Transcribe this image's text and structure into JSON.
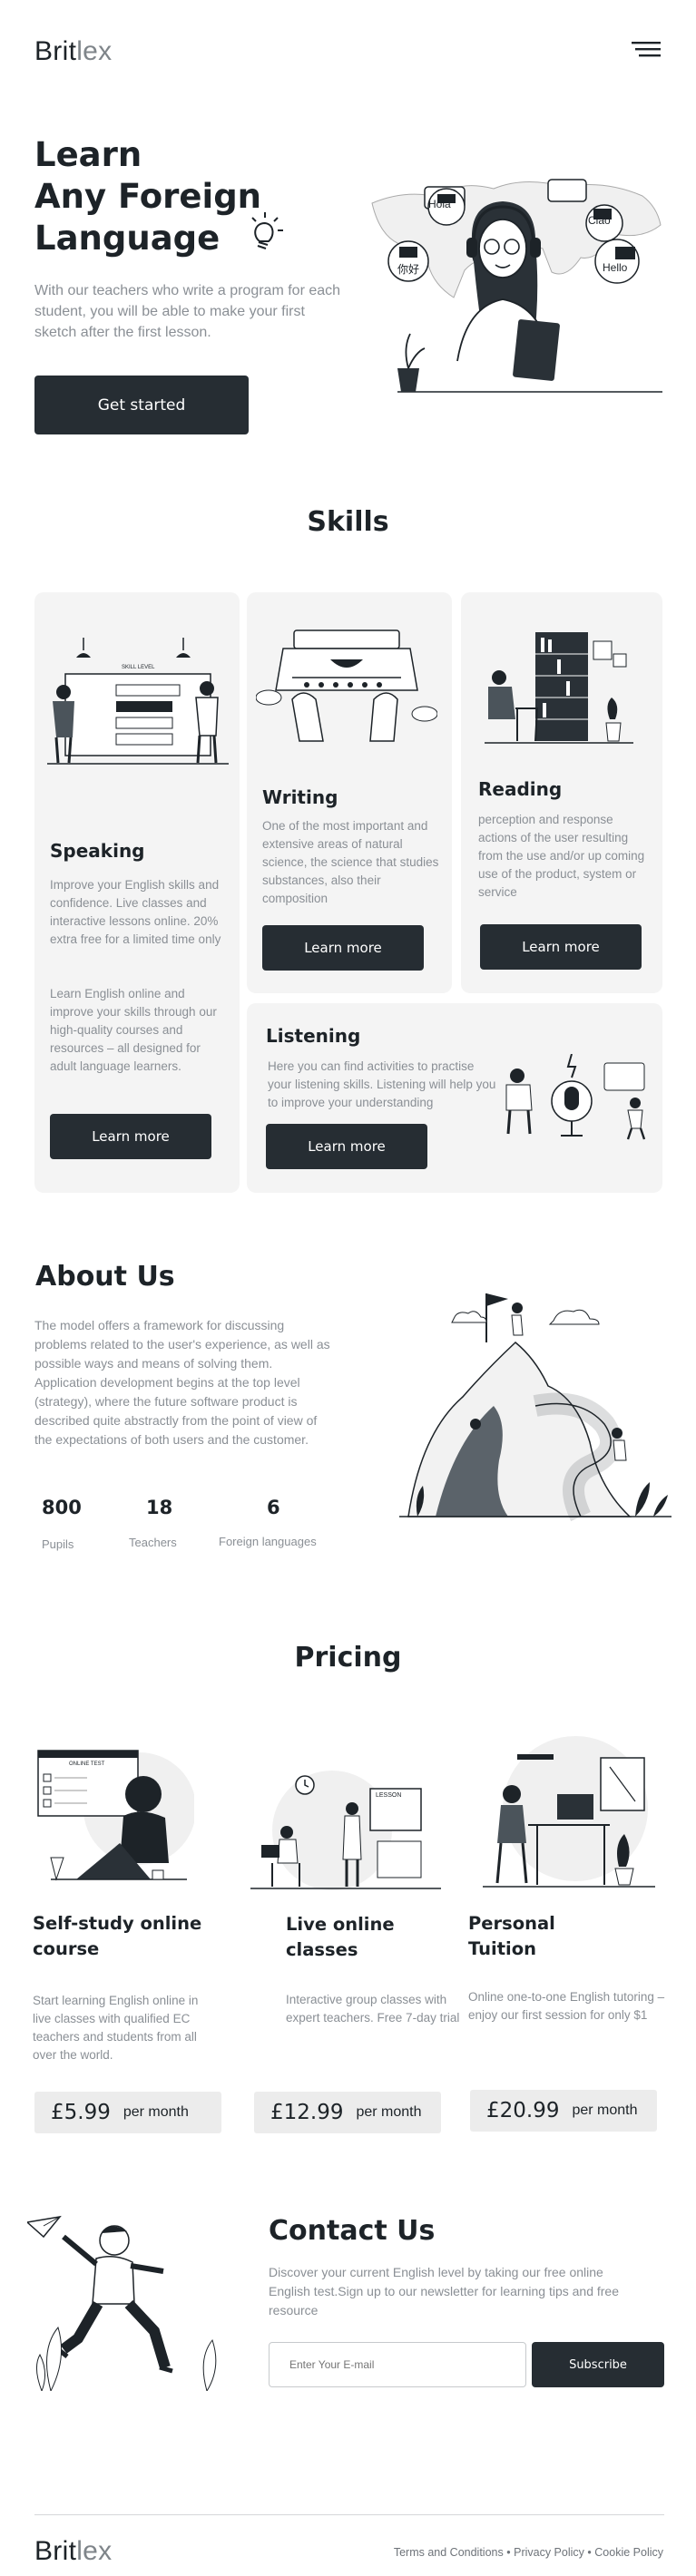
{
  "header": {
    "logo_main": "Brit",
    "logo_light": "lex"
  },
  "hero": {
    "title_line1": "Learn",
    "title_line2": "Any Foreign",
    "title_line3": "Language",
    "description": "With our teachers who write a program for each student, you will be able to make your first sketch after the first lesson.",
    "cta_label": "Get started",
    "bubbles": [
      "Hola",
      "Ciao",
      "你好",
      "Hello"
    ]
  },
  "skills": {
    "heading": "Skills",
    "speaking": {
      "title": "Speaking",
      "text1": "Improve your English skills and confidence. Live classes and interactive lessons online. 20% extra free for a limited time only",
      "text2": "Learn English online and improve your skills through our high-quality courses and resources – all designed for adult language learners.",
      "button": "Learn more",
      "board_label": "SKILL LEVEL"
    },
    "writing": {
      "title": "Writing",
      "text": "One of the most important and extensive areas of natural science, the science that studies substances, also their composition",
      "button": "Learn more"
    },
    "reading": {
      "title": "Reading",
      "text": "perception and response actions of the user resulting from the use and/or up coming use of the product, system or service",
      "button": "Learn more"
    },
    "listening": {
      "title": "Listening",
      "text": "Here you can find activities to practise your listening skills. Listening will help you to improve your understanding",
      "button": "Learn more"
    }
  },
  "about": {
    "heading": "About Us",
    "text": "The model offers a framework for discussing problems related to the user's experience, as well as possible ways and means of solving them. Application development begins at the top level (strategy), where the future software product is described quite abstractly from the point of view of the expectations of both users and the customer.",
    "stats": [
      {
        "value": "800",
        "label": "Pupils"
      },
      {
        "value": "18",
        "label": "Teachers"
      },
      {
        "value": "6",
        "label": "Foreign languages"
      }
    ]
  },
  "pricing": {
    "heading": "Pricing",
    "plans": [
      {
        "title_line1": "Self-study online",
        "title_line2": "course",
        "text": "Start learning English online in live classes with qualified EC teachers and students from all over the world.",
        "price": "£5.99",
        "period": "per month",
        "screen_label": "ONLINE TEST"
      },
      {
        "title_line1": "Live online",
        "title_line2": "classes",
        "text": "Interactive group classes with expert teachers. Free 7-day trial",
        "price": "£12.99",
        "period": "per month",
        "board_label": "LESSON"
      },
      {
        "title_line1": "Personal",
        "title_line2": "Tuition",
        "text": "Online one-to-one English tutoring – enjoy our first session for only $1",
        "price": "£20.99",
        "period": "per month"
      }
    ]
  },
  "contact": {
    "heading": "Contact Us",
    "text": "Discover your current English level by taking our free online English test.Sign up to our newsletter for learning tips and free resource",
    "email_placeholder": "Enter Your E-mail",
    "subscribe_label": "Subscribe"
  },
  "footer": {
    "logo_main": "Brit",
    "logo_light": "lex",
    "links": [
      "Terms and Conditions",
      "Privacy Policy",
      "Cookie Policy"
    ],
    "separator": "•"
  },
  "colors": {
    "dark": "#262d33",
    "card_bg": "#f4f4f4",
    "muted_text": "#8a8f95",
    "price_bg": "#ececec"
  }
}
